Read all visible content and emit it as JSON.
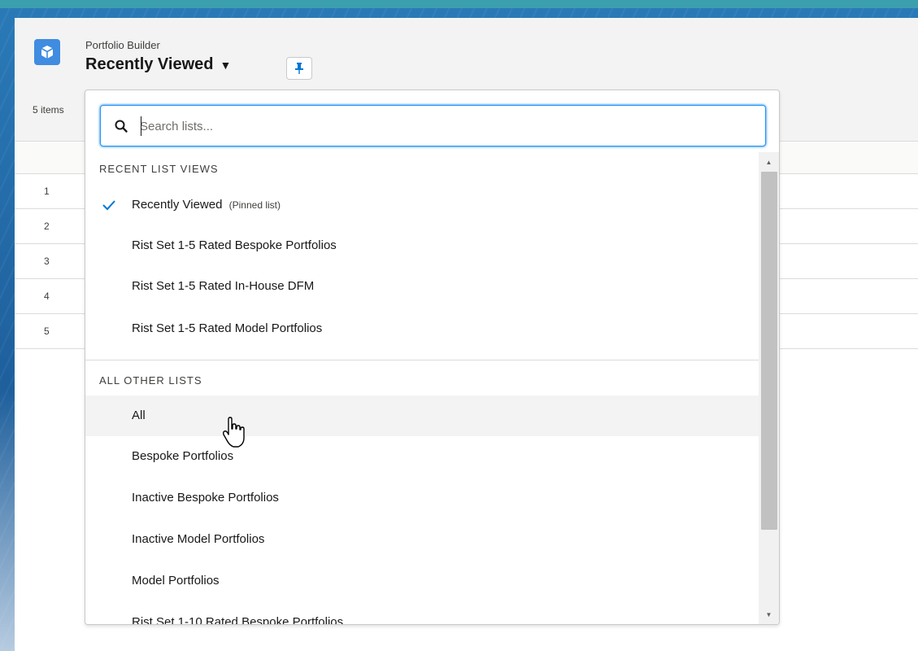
{
  "header": {
    "app_name": "Portfolio Builder",
    "list_title": "Recently Viewed",
    "items_count": "5 items"
  },
  "table": {
    "rows": [
      "1",
      "2",
      "3",
      "4",
      "5"
    ]
  },
  "dropdown": {
    "search_placeholder": "Search lists...",
    "recent_header": "RECENT LIST VIEWS",
    "recent_items": [
      {
        "label": "Recently Viewed",
        "note": "(Pinned list)",
        "selected": true
      },
      {
        "label": "Rist Set 1-5 Rated Bespoke Portfolios"
      },
      {
        "label": "Rist Set 1-5 Rated In-House DFM"
      },
      {
        "label": "Rist Set 1-5 Rated Model Portfolios"
      }
    ],
    "other_header": "ALL OTHER LISTS",
    "other_items": [
      {
        "label": "All",
        "hovered": true
      },
      {
        "label": "Bespoke Portfolios"
      },
      {
        "label": "Inactive Bespoke Portfolios"
      },
      {
        "label": "Inactive Model Portfolios"
      },
      {
        "label": "Model Portfolios"
      },
      {
        "label": "Rist Set 1-10 Rated Bespoke Portfolios"
      }
    ]
  },
  "colors": {
    "accent": "#0176d3",
    "app_icon": "#3f8ce0",
    "pin": "#0176d3"
  },
  "icons": {
    "app": "cube-icon",
    "pin": "pin-icon",
    "search": "search-icon",
    "check": "check-icon",
    "dropdown": "caret-down-icon",
    "cursor": "hand-pointer-icon"
  }
}
